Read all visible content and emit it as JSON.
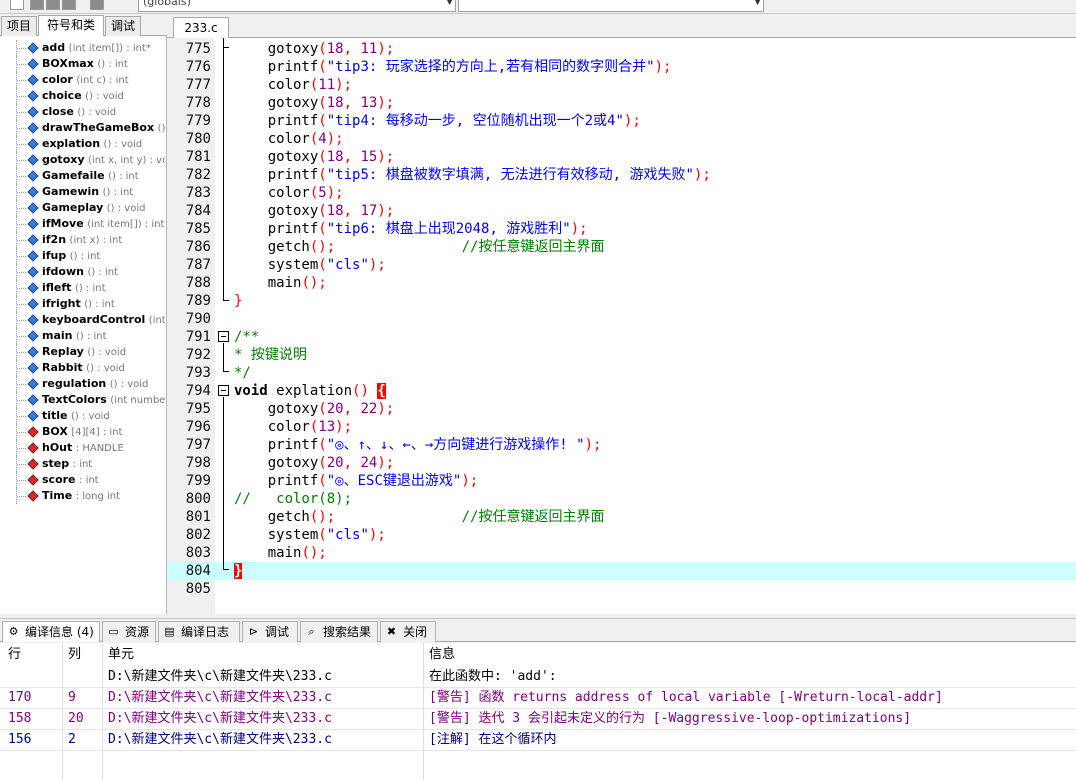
{
  "toolbar": {
    "globals_combo": "(globals)"
  },
  "left_tabs": [
    "项目",
    "符号和类",
    "调试"
  ],
  "symbols": [
    {
      "name": "add",
      "sig": "(int item[]) : int*",
      "kind": "fn"
    },
    {
      "name": "BOXmax",
      "sig": "() : int",
      "kind": "fn"
    },
    {
      "name": "color",
      "sig": "(int c) : int",
      "kind": "fn"
    },
    {
      "name": "choice",
      "sig": "() : void",
      "kind": "fn"
    },
    {
      "name": "close",
      "sig": "() : void",
      "kind": "fn"
    },
    {
      "name": "drawTheGameBox",
      "sig": "() :",
      "kind": "fn"
    },
    {
      "name": "explation",
      "sig": "() : void",
      "kind": "fn"
    },
    {
      "name": "gotoxy",
      "sig": "(int x, int y) : voi",
      "kind": "fn"
    },
    {
      "name": "Gamefaile",
      "sig": "() : int",
      "kind": "fn"
    },
    {
      "name": "Gamewin",
      "sig": "() : int",
      "kind": "fn"
    },
    {
      "name": "Gameplay",
      "sig": "() : void",
      "kind": "fn"
    },
    {
      "name": "ifMove",
      "sig": "(int item[]) : int",
      "kind": "fn"
    },
    {
      "name": "if2n",
      "sig": "(int x) : int",
      "kind": "fn"
    },
    {
      "name": "ifup",
      "sig": "() : int",
      "kind": "fn"
    },
    {
      "name": "ifdown",
      "sig": "() : int",
      "kind": "fn"
    },
    {
      "name": "ifleft",
      "sig": "() : int",
      "kind": "fn"
    },
    {
      "name": "ifright",
      "sig": "() : int",
      "kind": "fn"
    },
    {
      "name": "keyboardControl",
      "sig": "(int ke",
      "kind": "fn"
    },
    {
      "name": "main",
      "sig": "() : int",
      "kind": "fn"
    },
    {
      "name": "Replay",
      "sig": "() : void",
      "kind": "fn"
    },
    {
      "name": "Rabbit",
      "sig": "() : void",
      "kind": "fn"
    },
    {
      "name": "regulation",
      "sig": "() : void",
      "kind": "fn"
    },
    {
      "name": "TextColors",
      "sig": "(int number)",
      "kind": "fn"
    },
    {
      "name": "title",
      "sig": "() : void",
      "kind": "fn"
    },
    {
      "name": "BOX",
      "sig": "[4][4] : int",
      "kind": "var"
    },
    {
      "name": "hOut",
      "sig": ": HANDLE",
      "kind": "var"
    },
    {
      "name": "step",
      "sig": ": int",
      "kind": "var"
    },
    {
      "name": "score",
      "sig": ": int",
      "kind": "var"
    },
    {
      "name": "Time",
      "sig": ": long int",
      "kind": "var"
    }
  ],
  "editor_tab": "233.c",
  "code_lines": [
    {
      "n": "775",
      "t": [
        [
          "    gotoxy",
          ""
        ],
        [
          "(",
          "p"
        ],
        [
          "18",
          "n"
        ],
        [
          ", ",
          "p"
        ],
        [
          "11",
          "n"
        ],
        [
          ");",
          "p"
        ]
      ]
    },
    {
      "n": "776",
      "t": [
        [
          "    printf",
          ""
        ],
        [
          "(",
          "p"
        ],
        [
          "\"tip3: 玩家选择的方向上,若有相同的数字则合并\"",
          "s"
        ],
        [
          ");",
          "p"
        ]
      ]
    },
    {
      "n": "777",
      "t": [
        [
          "    color",
          ""
        ],
        [
          "(",
          "p"
        ],
        [
          "11",
          "n"
        ],
        [
          ");",
          "p"
        ]
      ]
    },
    {
      "n": "778",
      "t": [
        [
          "    gotoxy",
          ""
        ],
        [
          "(",
          "p"
        ],
        [
          "18",
          "n"
        ],
        [
          ", ",
          "p"
        ],
        [
          "13",
          "n"
        ],
        [
          ");",
          "p"
        ]
      ]
    },
    {
      "n": "779",
      "t": [
        [
          "    printf",
          ""
        ],
        [
          "(",
          "p"
        ],
        [
          "\"tip4: 每移动一步, 空位随机出现一个2或4\"",
          "s"
        ],
        [
          ");",
          "p"
        ]
      ]
    },
    {
      "n": "780",
      "t": [
        [
          "    color",
          ""
        ],
        [
          "(",
          "p"
        ],
        [
          "4",
          "n"
        ],
        [
          ");",
          "p"
        ]
      ]
    },
    {
      "n": "781",
      "t": [
        [
          "    gotoxy",
          ""
        ],
        [
          "(",
          "p"
        ],
        [
          "18",
          "n"
        ],
        [
          ", ",
          "p"
        ],
        [
          "15",
          "n"
        ],
        [
          ");",
          "p"
        ]
      ]
    },
    {
      "n": "782",
      "t": [
        [
          "    printf",
          ""
        ],
        [
          "(",
          "p"
        ],
        [
          "\"tip5: 棋盘被数字填满, 无法进行有效移动, 游戏失败\"",
          "s"
        ],
        [
          ");",
          "p"
        ]
      ]
    },
    {
      "n": "783",
      "t": [
        [
          "    color",
          ""
        ],
        [
          "(",
          "p"
        ],
        [
          "5",
          "n"
        ],
        [
          ");",
          "p"
        ]
      ]
    },
    {
      "n": "784",
      "t": [
        [
          "    gotoxy",
          ""
        ],
        [
          "(",
          "p"
        ],
        [
          "18",
          "n"
        ],
        [
          ", ",
          "p"
        ],
        [
          "17",
          "n"
        ],
        [
          ");",
          "p"
        ]
      ]
    },
    {
      "n": "785",
      "t": [
        [
          "    printf",
          ""
        ],
        [
          "(",
          "p"
        ],
        [
          "\"tip6: 棋盘上出现2048, 游戏胜利\"",
          "s"
        ],
        [
          ");",
          "p"
        ]
      ]
    },
    {
      "n": "786",
      "t": [
        [
          "    getch",
          ""
        ],
        [
          "();",
          "p"
        ],
        [
          "               //按任意键返回主界面",
          "c"
        ]
      ]
    },
    {
      "n": "787",
      "t": [
        [
          "    system",
          ""
        ],
        [
          "(",
          "p"
        ],
        [
          "\"cls\"",
          "s"
        ],
        [
          ");",
          "p"
        ]
      ]
    },
    {
      "n": "788",
      "t": [
        [
          "    main",
          ""
        ],
        [
          "();",
          "p"
        ]
      ]
    },
    {
      "n": "789",
      "t": [
        [
          "}",
          "p"
        ]
      ]
    },
    {
      "n": "790",
      "t": []
    },
    {
      "n": "791",
      "t": [
        [
          "/**",
          "c"
        ]
      ]
    },
    {
      "n": "792",
      "t": [
        [
          "* 按键说明",
          "c"
        ]
      ]
    },
    {
      "n": "793",
      "t": [
        [
          "*/",
          "c"
        ]
      ]
    },
    {
      "n": "794",
      "t": [
        [
          "void",
          "k"
        ],
        [
          " explation",
          ""
        ],
        [
          "() ",
          "p"
        ],
        [
          "{",
          "b"
        ]
      ]
    },
    {
      "n": "795",
      "t": [
        [
          "    gotoxy",
          ""
        ],
        [
          "(",
          "p"
        ],
        [
          "20",
          "n"
        ],
        [
          ", ",
          "p"
        ],
        [
          "22",
          "n"
        ],
        [
          ");",
          "p"
        ]
      ]
    },
    {
      "n": "796",
      "t": [
        [
          "    color",
          ""
        ],
        [
          "(",
          "p"
        ],
        [
          "13",
          "n"
        ],
        [
          ");",
          "p"
        ]
      ]
    },
    {
      "n": "797",
      "t": [
        [
          "    printf",
          ""
        ],
        [
          "(",
          "p"
        ],
        [
          "\"◎、↑、↓、←、→方向键进行游戏操作! \"",
          "s"
        ],
        [
          ");",
          "p"
        ]
      ]
    },
    {
      "n": "798",
      "t": [
        [
          "    gotoxy",
          ""
        ],
        [
          "(",
          "p"
        ],
        [
          "20",
          "n"
        ],
        [
          ", ",
          "p"
        ],
        [
          "24",
          "n"
        ],
        [
          ");",
          "p"
        ]
      ]
    },
    {
      "n": "799",
      "t": [
        [
          "    printf",
          ""
        ],
        [
          "(",
          "p"
        ],
        [
          "\"◎、ESC键退出游戏\"",
          "s"
        ],
        [
          ");",
          "p"
        ]
      ]
    },
    {
      "n": "800",
      "t": [
        [
          "//   color(8);",
          "c"
        ]
      ]
    },
    {
      "n": "801",
      "t": [
        [
          "    getch",
          ""
        ],
        [
          "();",
          "p"
        ],
        [
          "               //按任意键返回主界面",
          "c"
        ]
      ]
    },
    {
      "n": "802",
      "t": [
        [
          "    system",
          ""
        ],
        [
          "(",
          "p"
        ],
        [
          "\"cls\"",
          "s"
        ],
        [
          ");",
          "p"
        ]
      ]
    },
    {
      "n": "803",
      "t": [
        [
          "    main",
          ""
        ],
        [
          "();",
          "p"
        ]
      ]
    },
    {
      "n": "804",
      "t": [
        [
          "}",
          "b"
        ]
      ]
    },
    {
      "n": "805",
      "t": []
    }
  ],
  "bottom_tabs": [
    {
      "label": "编译信息 (4)",
      "icon": "compile-icon"
    },
    {
      "label": "资源",
      "icon": "resource-icon"
    },
    {
      "label": "编译日志",
      "icon": "log-icon"
    },
    {
      "label": "调试",
      "icon": "debug-icon"
    },
    {
      "label": "搜索结果",
      "icon": "search-icon"
    },
    {
      "label": "关闭",
      "icon": "close-icon"
    }
  ],
  "messages": {
    "headers": {
      "line": "行",
      "col": "列",
      "unit": "单元",
      "info": "信息"
    },
    "rows": [
      {
        "line": "",
        "col": "",
        "unit": "D:\\新建文件夹\\c\\新建文件夹\\233.c",
        "info": "在此函数中:  'add':",
        "kind": "plain"
      },
      {
        "line": "170",
        "col": "9",
        "unit": "D:\\新建文件夹\\c\\新建文件夹\\233.c",
        "info": "[警告] 函数 returns address of local variable [-Wreturn-local-addr]",
        "kind": "warn"
      },
      {
        "line": "158",
        "col": "20",
        "unit": "D:\\新建文件夹\\c\\新建文件夹\\233.c",
        "info": "[警告] 迭代 3 会引起未定义的行为 [-Waggressive-loop-optimizations]",
        "kind": "warn"
      },
      {
        "line": "156",
        "col": "2",
        "unit": "D:\\新建文件夹\\c\\新建文件夹\\233.c",
        "info": "[注解] 在这个循环内",
        "kind": "note"
      }
    ]
  }
}
